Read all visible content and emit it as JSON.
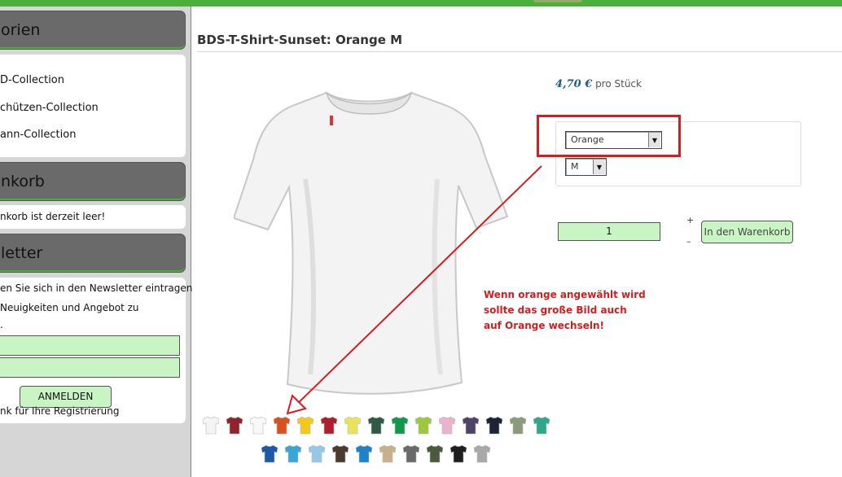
{
  "sidebar": {
    "categories_title": "orien",
    "categories": [
      "D-Collection",
      "chützen-Collection",
      "ann-Collection"
    ],
    "cart_title": "nkorb",
    "cart_text": "nkorb ist derzeit leer!",
    "newsletter_title": "letter",
    "newsletter_lines": [
      "en Sie sich in den Newsletter eintragen",
      "Neuigkeiten und Angebot zu",
      "."
    ],
    "subscribe_label": "ANMELDEN",
    "thanks_text": "nk für Ihre Registrierung"
  },
  "product": {
    "title": "BDS-T-Shirt-Sunset: Orange M",
    "price": "4,70 €",
    "price_unit": "pro Stück",
    "color_select": "Orange",
    "size_select": "M",
    "quantity": "1",
    "stepper_plus": "+",
    "stepper_minus": "–",
    "add_to_cart_label": "In den Warenkorb"
  },
  "annotation": {
    "lines": [
      "Wenn orange angewählt wird",
      "sollte das große Bild auch",
      "auf Orange wechseln!"
    ],
    "color": "#d21e1e"
  },
  "swatches": {
    "row1": [
      "#f4f4f4",
      "#8e2430",
      "#f8f8f8",
      "#d8521e",
      "#f2c81c",
      "#b31c2a",
      "#e8e45a",
      "#2f5a46",
      "#12984a",
      "#9cc83a",
      "#eab2cc",
      "#4e4468",
      "#1a2436",
      "#8a9a7a",
      "#2ea88a"
    ],
    "row2": [
      "#1a5aa8",
      "#3aa6d6",
      "#94c8e4",
      "#4a3a30",
      "#1d82c8",
      "#c8b08a",
      "#6a6a6a",
      "#4a5a3a",
      "#1e1e1e",
      "#a8a8a8"
    ]
  },
  "colors": {
    "button_green": "#c9f5c4",
    "header_grey": "#6a6a6a",
    "top_green": "#4caf3c",
    "price_blue": "#1f5a7a"
  }
}
